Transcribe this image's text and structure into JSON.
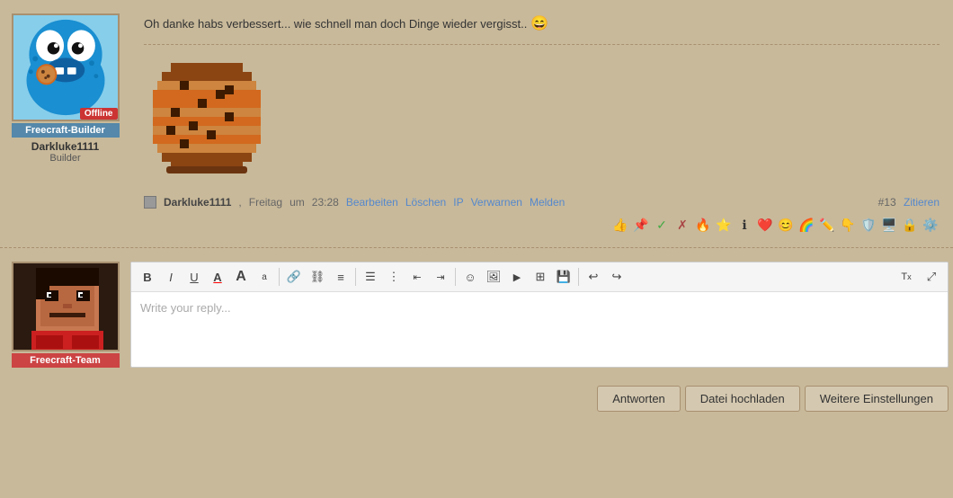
{
  "post": {
    "text": "Oh danke habs verbessert... wie schnell man doch Dinge wieder vergisst..",
    "emoji": "😄",
    "user": {
      "name": "Darkluke1111",
      "title": "Builder",
      "role": "Freecraft-Builder",
      "status": "Offline"
    },
    "meta": {
      "username": "Darkluke1111",
      "day": "Freitag",
      "time": "23:28",
      "number": "#13",
      "actions": {
        "edit": "Bearbeiten",
        "delete": "Löschen",
        "ip": "IP",
        "warn": "Verwarnen",
        "report": "Melden",
        "quote": "Zitieren"
      }
    }
  },
  "reply": {
    "user": {
      "role": "Freecraft-Team"
    },
    "editor": {
      "placeholder": "Write your reply...",
      "toolbar": {
        "bold": "B",
        "italic": "I",
        "underline": "U",
        "font_color": "A",
        "font_size_large": "A",
        "font_size_small": "a",
        "link": "🔗",
        "unlink": "⛓",
        "align": "≡",
        "list_unordered": "☰",
        "list_ordered": "☷",
        "outdent": "⇤",
        "indent": "⇥",
        "emoji": "☺",
        "image": "🖼",
        "video": "▶",
        "table": "⊞",
        "save": "💾",
        "undo": "↩",
        "redo": "↪",
        "format_clear": "Tx",
        "fullscreen": "⤢"
      }
    },
    "buttons": {
      "reply": "Antworten",
      "upload": "Datei hochladen",
      "settings": "Weitere Einstellungen"
    }
  }
}
